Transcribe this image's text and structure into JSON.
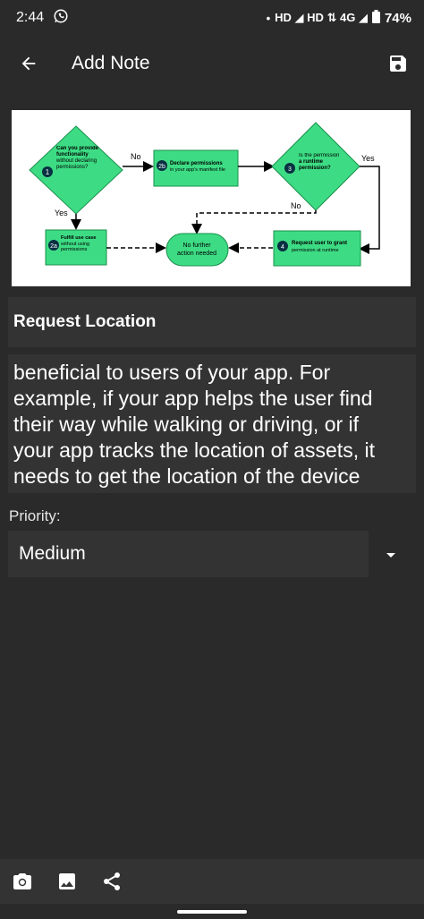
{
  "status_bar": {
    "time": "2:44",
    "network": "HD ◢ HD ⇅ 4G ◢",
    "battery": "74%"
  },
  "toolbar": {
    "title": "Add Note",
    "back_icon": "arrow-back-icon",
    "save_icon": "save-icon"
  },
  "diagram": {
    "step1_num": "1",
    "step1_bold": "Can you provide functionality",
    "step1_text": "without declaring permissions?",
    "no1": "No",
    "step2b_num": "2b",
    "step2b_bold": "Declare permissions",
    "step2b_text": "in your app's manifest file",
    "step3_num": "3",
    "step3_pre": "Is the permission",
    "step3_bold": "a runtime permission?",
    "yes3": "Yes",
    "no3": "No",
    "yes1": "Yes",
    "step2a_num": "2a",
    "step2a_bold": "Fulfill use case",
    "step2a_text": "without using permissions",
    "center_line1": "No further",
    "center_line2": "action needed",
    "step4_num": "4",
    "step4_bold": "Request user to grant",
    "step4_text": "permission at runtime"
  },
  "note": {
    "title": "Request Location",
    "body_lines": [
      "beneficial to users of your app. For",
      "example, if your app helps the user find",
      "their way while walking or driving, or if",
      "your app tracks the location of assets, it",
      "needs to get the location of the device"
    ]
  },
  "priority": {
    "label": "Priority:",
    "selected": "Medium"
  },
  "bottom_bar": {
    "icons": [
      "camera-icon",
      "image-icon",
      "share-icon"
    ]
  },
  "colors": {
    "background": "#2a2a2a",
    "field": "#333333",
    "diagram_green": "#3ddc84"
  }
}
